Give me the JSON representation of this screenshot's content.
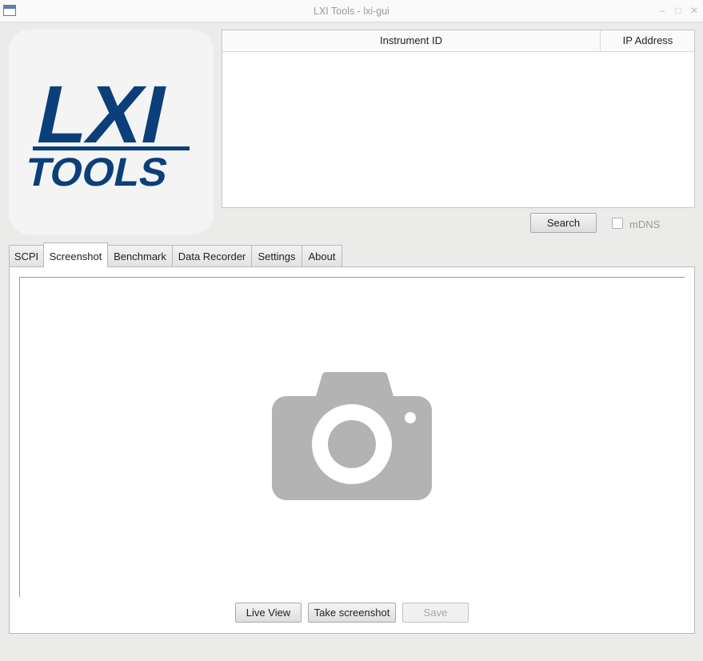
{
  "window": {
    "title": "LXI Tools - lxi-gui",
    "minimize_glyph": "–",
    "maximize_glyph": "□",
    "close_glyph": "✕"
  },
  "logo": {
    "line1": "LXI",
    "line2": "TOOLS",
    "color": "#0b3f7a"
  },
  "instrument_table": {
    "columns": [
      "Instrument ID",
      "IP Address"
    ],
    "rows": []
  },
  "search": {
    "button_label": "Search",
    "mdns_label": "mDNS",
    "mdns_checked": false
  },
  "tabs": [
    {
      "label": "SCPI",
      "active": false
    },
    {
      "label": "Screenshot",
      "active": true
    },
    {
      "label": "Benchmark",
      "active": false
    },
    {
      "label": "Data Recorder",
      "active": false
    },
    {
      "label": "Settings",
      "active": false
    },
    {
      "label": "About",
      "active": false
    }
  ],
  "screenshot": {
    "placeholder_icon": "camera-icon",
    "live_view_label": "Live View",
    "take_screenshot_label": "Take screenshot",
    "save_label": "Save",
    "save_enabled": false
  },
  "colors": {
    "camera_icon": "#b3b3b3",
    "logo_blue": "#0b3f7a"
  }
}
